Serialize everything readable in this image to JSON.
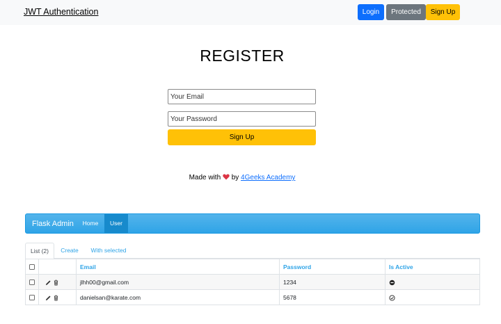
{
  "navbar": {
    "brand": "JWT Authentication",
    "login_label": "Login",
    "protected_label": "Protected",
    "signup_label": "Sign Up"
  },
  "register": {
    "title": "REGISTER",
    "email_placeholder": "Your Email",
    "password_placeholder": "Your Password",
    "submit_label": "Sign Up"
  },
  "footer": {
    "made_with": "Made with",
    "by": "by",
    "link_text": "4Geeks Academy"
  },
  "admin": {
    "brand": "Flask Admin",
    "nav": [
      "Home",
      "User"
    ],
    "active_nav": "User",
    "tabs": [
      "List (2)",
      "Create",
      "With selected"
    ],
    "active_tab": "List (2)",
    "table": {
      "columns": [
        "Email",
        "Password",
        "Is Active"
      ],
      "rows": [
        {
          "email": "jlhh00@gmail.com",
          "password": "1234",
          "is_active": false
        },
        {
          "email": "danielsan@karate.com",
          "password": "5678",
          "is_active": true
        }
      ]
    }
  },
  "colors": {
    "primary": "#0d6efd",
    "secondary": "#6c757d",
    "warning": "#ffc107",
    "admin_blue": "#2fa4e7",
    "heart": "#dc3545"
  }
}
